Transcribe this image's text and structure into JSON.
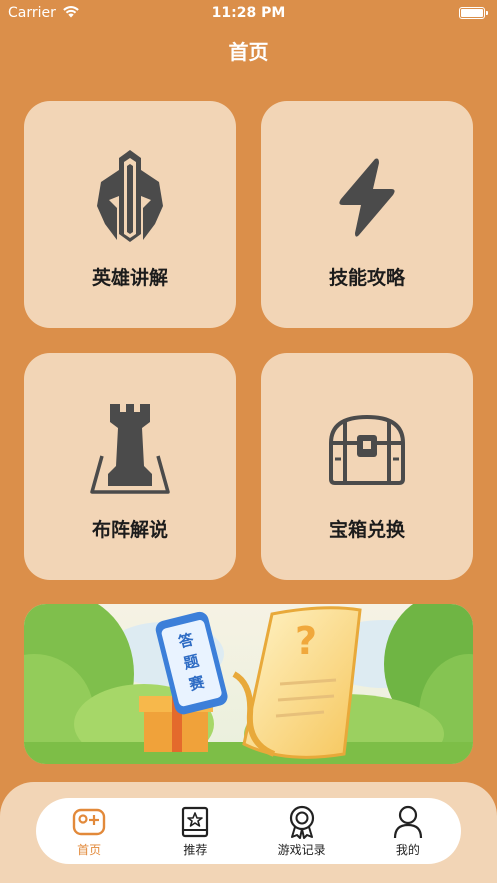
{
  "status_bar": {
    "carrier": "Carrier",
    "time": "11:28 PM"
  },
  "page": {
    "title": "首页"
  },
  "cards": [
    {
      "label": "英雄讲解",
      "icon": "helmet-icon"
    },
    {
      "label": "技能攻略",
      "icon": "lightning-icon"
    },
    {
      "label": "布阵解说",
      "icon": "chess-rook-icon"
    },
    {
      "label": "宝箱兑换",
      "icon": "treasure-chest-icon"
    }
  ],
  "banner": {
    "phone_text": "答题赛",
    "scroll_symbol": "?"
  },
  "tab_bar": {
    "active_index": 0,
    "tabs": [
      {
        "label": "首页",
        "icon": "gamepad-icon"
      },
      {
        "label": "推荐",
        "icon": "star-book-icon"
      },
      {
        "label": "游戏记录",
        "icon": "award-badge-icon"
      },
      {
        "label": "我的",
        "icon": "person-icon"
      }
    ]
  },
  "colors": {
    "background": "#DB8F4A",
    "card": "#F2D5B6",
    "icon": "#4B4B4B",
    "tab_active": "#E2893A"
  }
}
